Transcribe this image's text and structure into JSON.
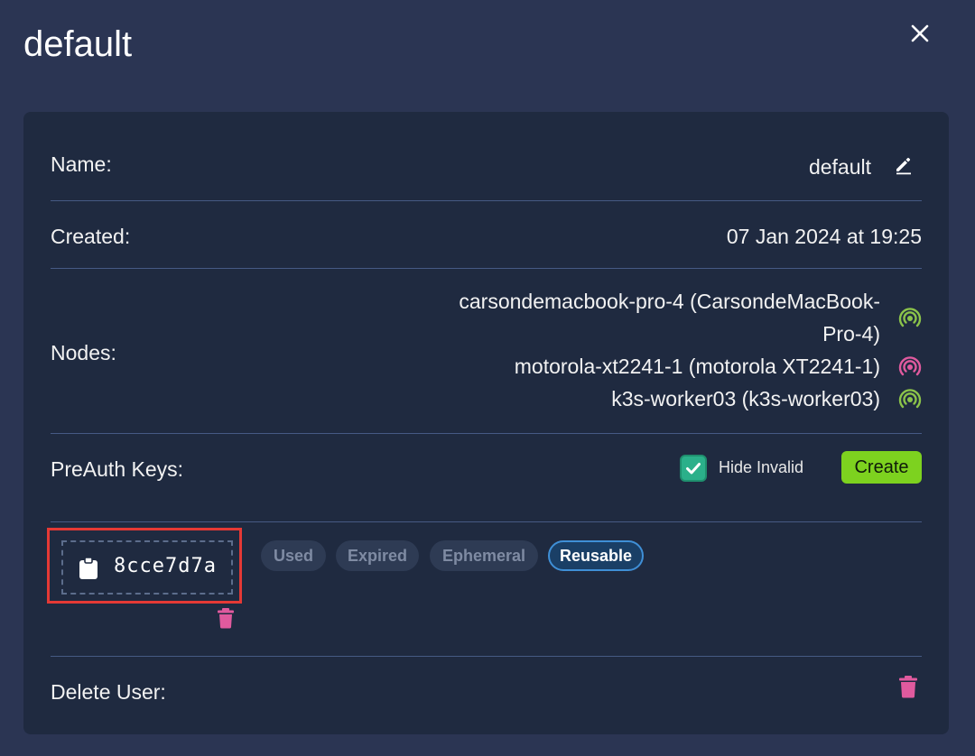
{
  "dialog": {
    "title": "default"
  },
  "fields": {
    "name_label": "Name:",
    "name_value": "default",
    "created_label": "Created:",
    "created_value": "07 Jan 2024 at 19:25",
    "nodes_label": "Nodes:",
    "nodes": [
      {
        "line1": "carsondemacbook-pro-4 (CarsondeMacBook-",
        "line2": "Pro-4)",
        "status": "online",
        "status_color": "#8bc34a"
      },
      {
        "line1": "motorola-xt2241-1 (motorola XT2241-1)",
        "status": "offline",
        "status_color": "#e05a9e"
      },
      {
        "line1": "k3s-worker03 (k3s-worker03)",
        "status": "online",
        "status_color": "#8bc34a"
      }
    ],
    "preauth_label": "PreAuth Keys:",
    "hide_invalid_label": "Hide Invalid",
    "hide_invalid_checked": true,
    "create_label": "Create",
    "delete_user_label": "Delete User:"
  },
  "preauth_keys": [
    {
      "key": "8cce7d7a",
      "tags": [
        {
          "label": "Used",
          "active": false
        },
        {
          "label": "Expired",
          "active": false
        },
        {
          "label": "Ephemeral",
          "active": false
        },
        {
          "label": "Reusable",
          "active": true
        }
      ]
    }
  ],
  "colors": {
    "background": "#2b3553",
    "card": "#1f2a40",
    "accent_green": "#7dd21f",
    "checkbox": "#2bb08a",
    "danger": "#e05a9e",
    "highlight": "#e53935",
    "active_tag": "#3f8fd6"
  },
  "icons": {
    "close": "close-icon",
    "edit": "edit-icon",
    "node_status": "signal-icon",
    "clipboard": "clipboard-icon",
    "trash": "trash-icon",
    "check": "check-icon"
  }
}
